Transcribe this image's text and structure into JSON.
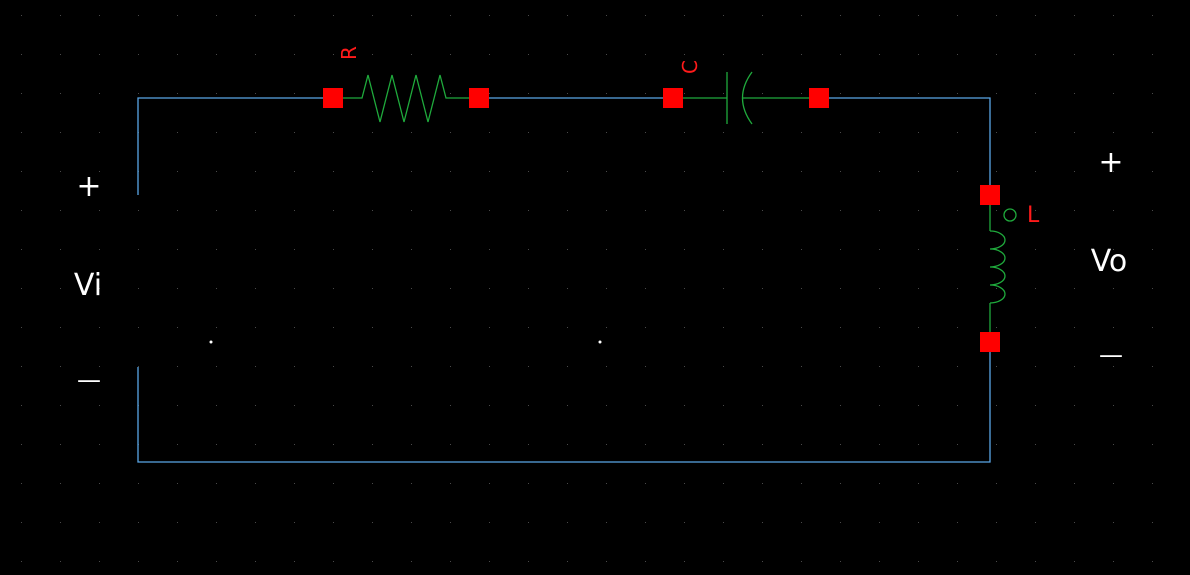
{
  "schematic": {
    "input_label": "Vi",
    "output_label": "Vo",
    "plus_sign": "+",
    "minus_sign": "—",
    "resistor_label": "R",
    "capacitor_label": "C",
    "inductor_label": "L"
  },
  "colors": {
    "background": "#000000",
    "wire": "#5aa6e6",
    "component": "#1faa3c",
    "pin": "#ff0000",
    "label_component": "#ff1a1a",
    "label_port": "#ffffff",
    "grid_dot": "#4a4a4a"
  }
}
